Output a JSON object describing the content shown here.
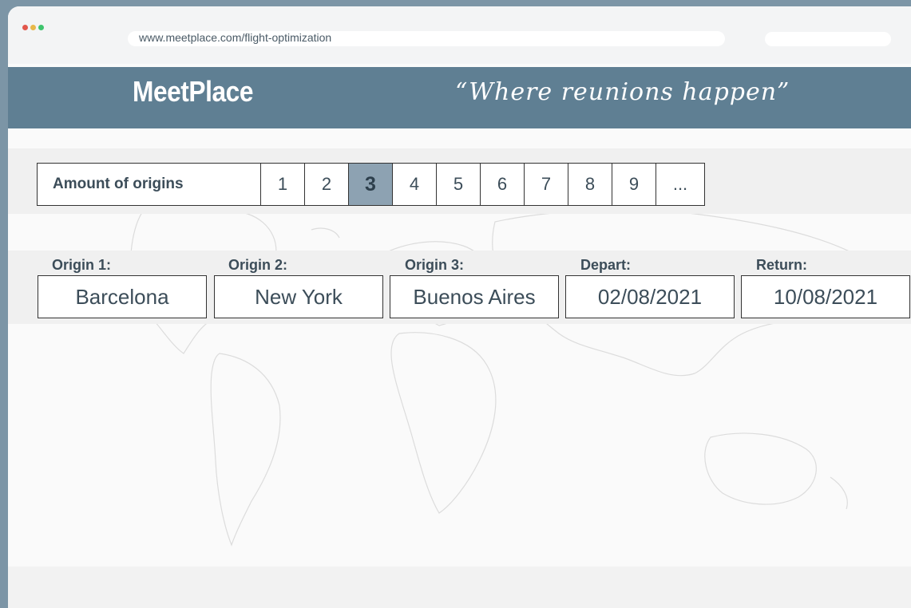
{
  "browser": {
    "url": "www.meetplace.com/flight-optimization"
  },
  "header": {
    "brand": "MeetPlace",
    "tagline": "“Where reunions happen”"
  },
  "origins_selector": {
    "label": "Amount of origins",
    "options": [
      "1",
      "2",
      "3",
      "4",
      "5",
      "6",
      "7",
      "8",
      "9",
      "..."
    ],
    "selected": "3"
  },
  "form": {
    "origin1": {
      "label": "Origin 1:",
      "value": "Barcelona"
    },
    "origin2": {
      "label": "Origin 2:",
      "value": "New York"
    },
    "origin3": {
      "label": "Origin 3:",
      "value": "Buenos Aires"
    },
    "depart": {
      "label": "Depart:",
      "value": "02/08/2021"
    },
    "return": {
      "label": "Return:",
      "value": "10/08/2021"
    }
  },
  "colors": {
    "header": "#5f7f93",
    "active_option": "#8da2b2",
    "frame": "#7c95a6"
  }
}
